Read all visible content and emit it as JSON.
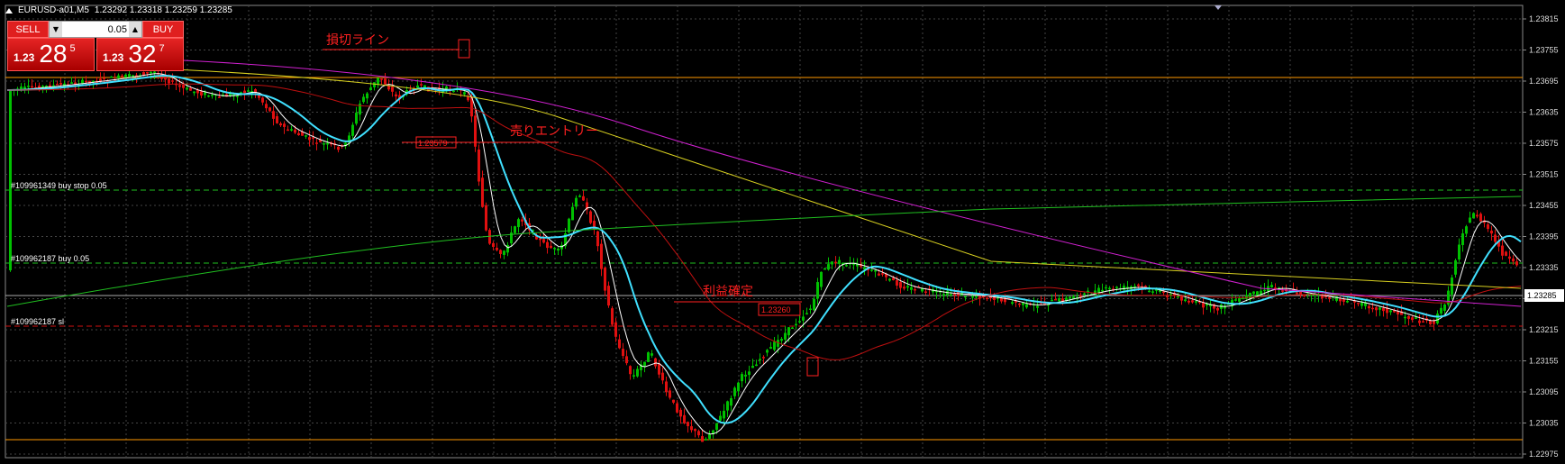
{
  "header": {
    "symbol": "EURUSD-a01,M5",
    "ohlc": "1.23292 1.23318 1.23259 1.23285"
  },
  "trade_panel": {
    "sell_label": "SELL",
    "buy_label": "BUY",
    "lot_value": "0.05",
    "sell_price": {
      "prefix": "1.23",
      "big": "28",
      "pip": "5"
    },
    "buy_price": {
      "prefix": "1.23",
      "big": "32",
      "pip": "7"
    }
  },
  "price_axis": {
    "ticks": [
      "1.23815",
      "1.23755",
      "1.23695",
      "1.23635",
      "1.23575",
      "1.23515",
      "1.23455",
      "1.23395",
      "1.23335",
      "1.23275",
      "1.23215",
      "1.23155",
      "1.23095",
      "1.23035",
      "1.22975"
    ],
    "current_price": "1.23285"
  },
  "orders": {
    "buy_stop": "#109961349 buy stop 0.05",
    "buy": "#109962187 buy 0.05",
    "sl": "#109962187 sl"
  },
  "annotations": {
    "stop_loss": "損切ライン",
    "sell_entry": "売りエントリー",
    "take_profit": "利益確定",
    "entry_price_tag": "1.23579",
    "exit_price_tag": "1.23260"
  },
  "colors": {
    "background": "#000000",
    "grid": "#444444",
    "up_candle": "#00c000",
    "down_candle": "#e01010",
    "ma_cyan": "#40e0ff",
    "ma_white": "#ffffff",
    "ma_magenta": "#d020d0",
    "ma_yellow": "#d8d020",
    "ma_red": "#c01010",
    "ma_green": "#20c020",
    "orange_line": "#ff9900"
  }
}
